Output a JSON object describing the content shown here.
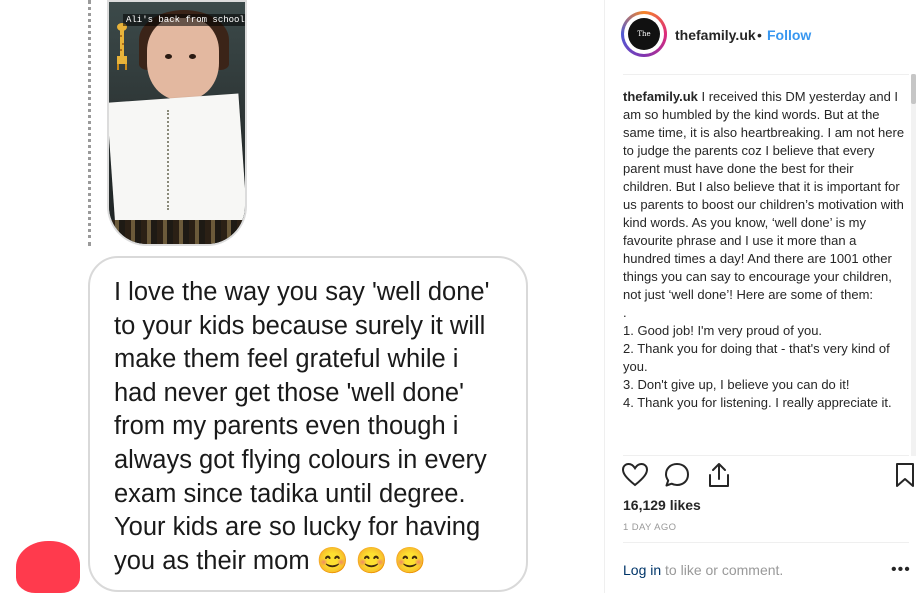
{
  "post": {
    "story_caption": "Ali's back from school!",
    "message": "I love the way you say 'well done'\nto your kids because surely it will\nmake them feel grateful while i\nhad never get those 'well done'\nfrom my parents even though i\nalways got flying colours in every\nexam since tadika until degree.\nYour kids are so lucky for having\nyou as their mom 😊 😊 😊"
  },
  "header": {
    "avatar_text": "The Family",
    "username": "thefamily.uk",
    "separator": "•",
    "follow_label": "Follow"
  },
  "caption": {
    "username": "thefamily.uk",
    "text": " I received this DM yesterday and I am so humbled by the kind words. But at the same time, it is also heartbreaking. I am not here to judge the parents coz I believe that every parent must have done the best for their children. But I also believe that it is important for us parents to boost our children’s motivation with kind words. As you know, ‘well done’ is my favourite phrase and I use it more than a hundred times a day! And there are 1001 other things you can say to encourage your children, not just ‘well done’! Here are some of them:\n.\n1. Good job! I'm very proud of you.\n2. Thank you for doing that - that's very kind of you.\n3. Don't give up, I believe you can do it!\n4. Thank you for listening. I really appreciate it."
  },
  "actions": {
    "icons": [
      "heart-icon",
      "comment-icon",
      "share-icon",
      "bookmark-icon"
    ]
  },
  "likes": "16,129 likes",
  "timestamp": "1 DAY AGO",
  "login": {
    "link": "Log in",
    "text": " to like or comment."
  },
  "more_label": "•••",
  "colors": {
    "follow": "#3897f0",
    "text": "#262626",
    "muted": "#999999",
    "login_link": "#003569",
    "red_blob": "#ff3a4d"
  }
}
